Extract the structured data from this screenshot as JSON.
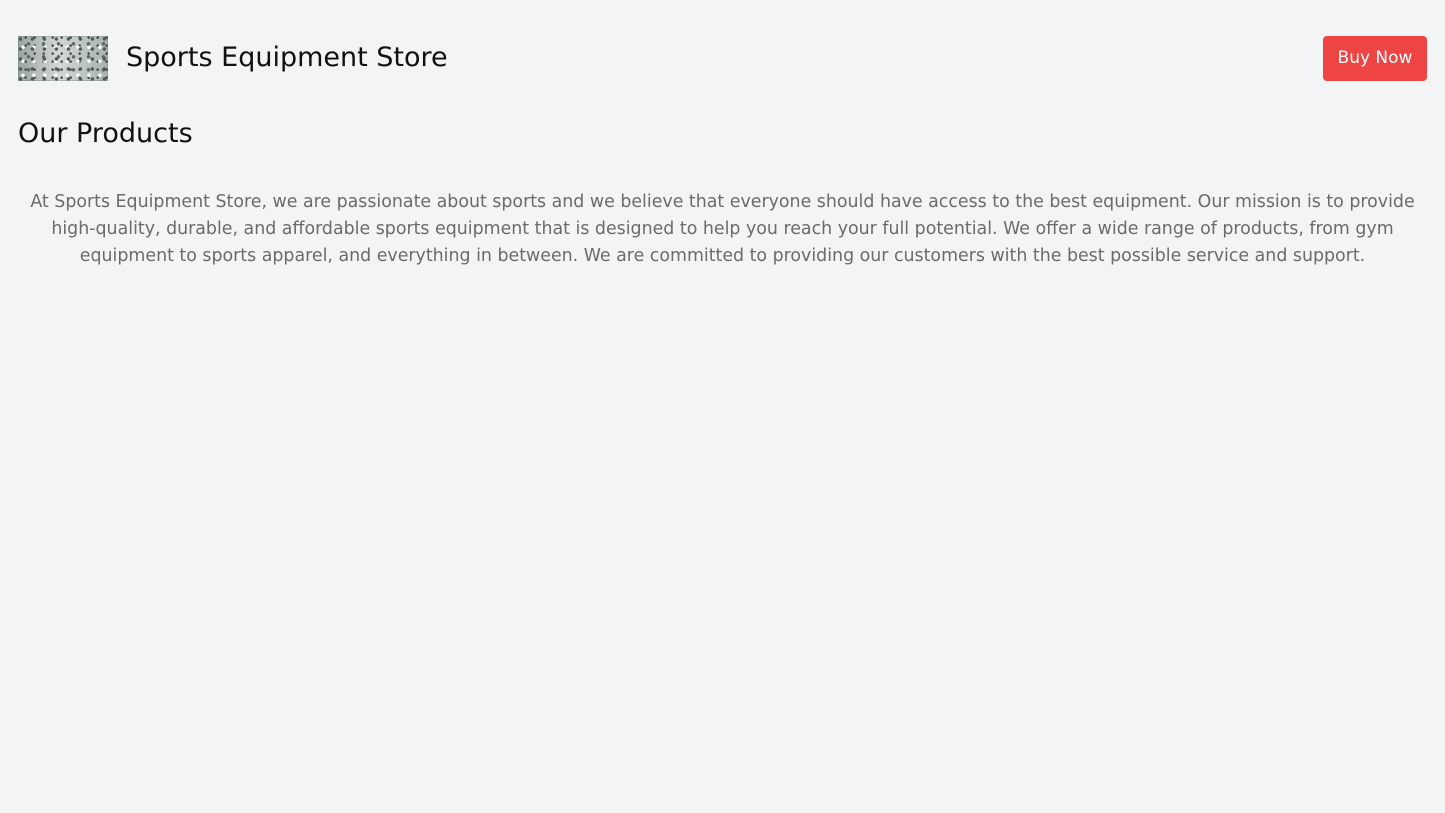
{
  "header": {
    "logo_alt": "Sports Equipment Store logo",
    "store_name": "Sports Equipment Store",
    "buy_button_label": "Buy Now"
  },
  "main": {
    "section_title": "Our Products",
    "description": "At Sports Equipment Store, we are passionate about sports and we believe that everyone should have access to the best equipment. Our mission is to provide high-quality, durable, and affordable sports equipment that is designed to help you reach your full potential. We offer a wide range of products, from gym equipment to sports apparel, and everything in between. We are committed to providing our customers with the best possible service and support."
  },
  "colors": {
    "background": "#f3f4f6",
    "accent": "#ef4444",
    "body_text": "#6b6b6b",
    "heading_text": "#111111"
  }
}
